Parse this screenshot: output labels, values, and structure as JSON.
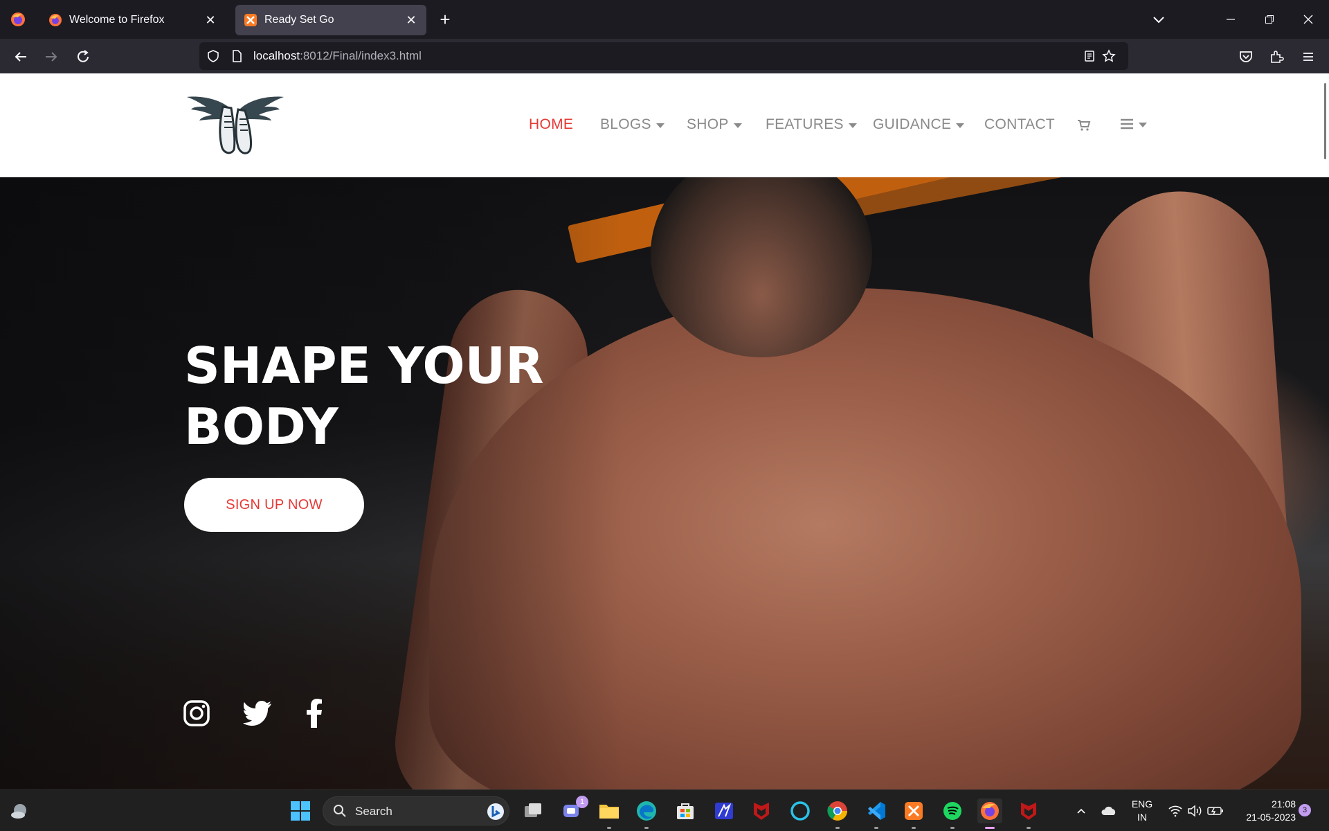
{
  "browser": {
    "tabs": [
      {
        "title": "Welcome to Firefox",
        "active": false
      },
      {
        "title": "Ready Set Go",
        "active": true
      }
    ],
    "url": {
      "host": "localhost",
      "rest": ":8012/Final/index3.html"
    }
  },
  "site": {
    "nav": {
      "home": "HOME",
      "blogs": "BLOGS",
      "shop": "SHOP",
      "features": "FEATURES",
      "guidance": "GUIDANCE",
      "contact": "CONTACT"
    },
    "hero": {
      "title_line1": "SHAPE YOUR",
      "title_line2": "BODY",
      "cta": "SIGN UP NOW"
    },
    "social": [
      "instagram-icon",
      "twitter-icon",
      "facebook-icon"
    ],
    "colors": {
      "accent": "#e53935",
      "nav_text": "#8a8a8a"
    }
  },
  "taskbar": {
    "search_label": "Search",
    "teams_badge": "1",
    "lang_line1": "ENG",
    "lang_line2": "IN",
    "time": "21:08",
    "date": "21-05-2023",
    "notification_count": "3"
  }
}
